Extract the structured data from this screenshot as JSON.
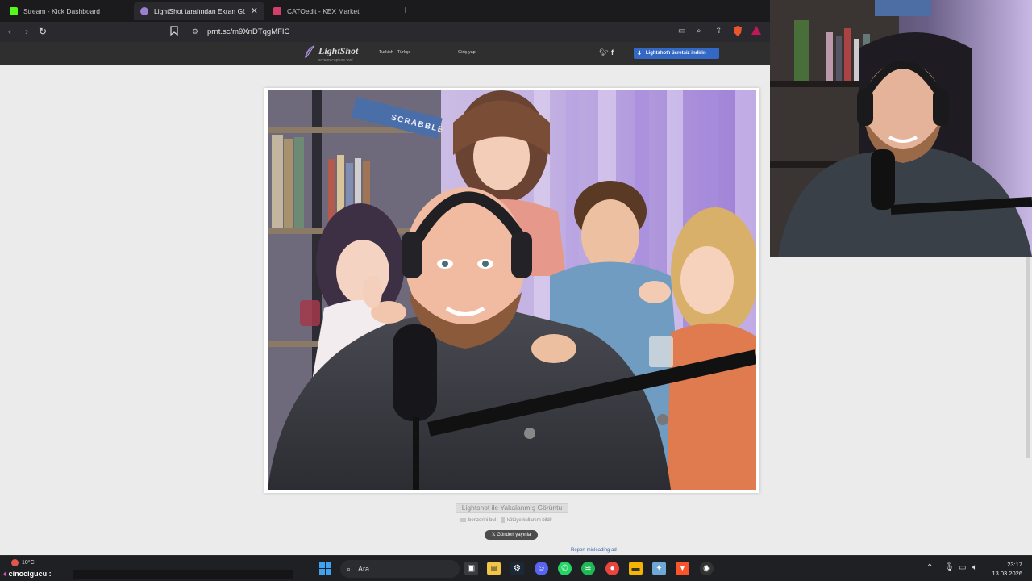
{
  "browser": {
    "tabs": [
      {
        "title": "Stream - Kick Dashboard",
        "favicon_color": "#53fc18"
      },
      {
        "title": "LightShot tarafından Ekran Görü",
        "favicon_color": "#9b7fd0"
      },
      {
        "title": "CATOedit - KEX Market",
        "favicon_color": "#d23f6a"
      }
    ],
    "url": "prnt.sc/m9XnDTqgMFIC"
  },
  "lightshot": {
    "logo_name": "LightShot",
    "logo_tagline": "screen capture tool",
    "language": "Turkish - Türkçe",
    "login": "Giriş yap",
    "download_button": "Lightshot'ı ücretsiz indirin",
    "caption": "Lightshot ile Yakalanmış Görüntu",
    "find_similar": "benzerini bul",
    "report_abuse": "kötüye kullanım bildir",
    "share_post": "Gönderi yayınla",
    "report_ad": "Report misleading ad",
    "screenshot_box_label": "SCRABBLE"
  },
  "taskbar": {
    "weather": "10°C",
    "chat_user": "cinocigucu :",
    "search_label": "Ara",
    "time": "23:17",
    "date": "13.03.2026"
  }
}
